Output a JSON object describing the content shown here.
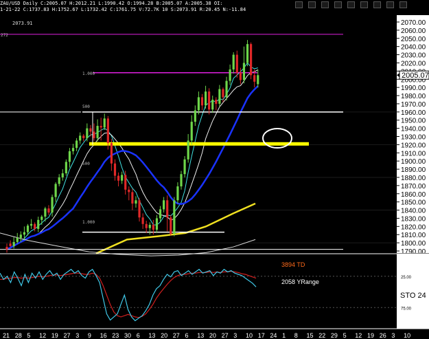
{
  "header": {
    "line1": "ZAU/USD  Daily  C:2005.07  H:2012.21  L:1990.42  O:1994.28  B:2005.07  A:2005.38  OI:",
    "line2": "1-21-22  C:1737.83  H:1752.67  L:1732.42  C:1761.75  V:72.7K  10  S:2073.91  R:20.45  N:-11.84",
    "ref_price": "2073.91"
  },
  "toolbar": {
    "buttons": [
      "arrow-down-icon",
      "pencil-icon",
      "zoom-icon",
      "cursor-icon",
      "box-icon",
      "arrow-down-icon",
      "plus-icon",
      "minus-icon",
      "close-icon"
    ]
  },
  "left_labels": [
    "272",
    "1.000",
    "500",
    "1.000",
    "500"
  ],
  "chart_data": {
    "type": "candlestick",
    "y_axis": {
      "min": 1780,
      "max": 2075,
      "ticks": [
        "2070.00",
        "2060.00",
        "2050.00",
        "2040.00",
        "2030.00",
        "2020.00",
        "2010.00",
        "2000.00",
        "1990.00",
        "1980.00",
        "1970.00",
        "1960.00",
        "1950.00",
        "1940.00",
        "1930.00",
        "1920.00",
        "1910.00",
        "1900.00",
        "1890.00",
        "1880.00",
        "1870.00",
        "1860.00",
        "1850.00",
        "1840.00",
        "1830.00",
        "1820.00",
        "1810.00",
        "1800.00",
        "1790.00"
      ]
    },
    "last_price_label": "2005.07",
    "x_tick_labels": [
      "21",
      "28",
      "5",
      "12",
      "19",
      "27",
      "3",
      "9",
      "16",
      "23",
      "30",
      "6",
      "13",
      "20",
      "27",
      "6",
      "13",
      "20",
      "27",
      "3",
      "10",
      "17",
      "24",
      "1",
      "8",
      "15",
      "22",
      "29",
      "5",
      "12",
      "19",
      "26",
      "3",
      "10"
    ],
    "candles": [
      [
        1795,
        1792,
        1788,
        1799
      ],
      [
        1799,
        1796,
        1795,
        1803
      ],
      [
        1796,
        1801,
        1793,
        1807
      ],
      [
        1801,
        1806,
        1799,
        1812
      ],
      [
        1806,
        1810,
        1801,
        1814
      ],
      [
        1810,
        1813,
        1804,
        1820
      ],
      [
        1813,
        1821,
        1809,
        1823
      ],
      [
        1821,
        1823,
        1817,
        1829
      ],
      [
        1823,
        1817,
        1814,
        1825
      ],
      [
        1817,
        1828,
        1813,
        1832
      ],
      [
        1828,
        1832,
        1822,
        1834
      ],
      [
        1832,
        1842,
        1826,
        1844
      ],
      [
        1842,
        1837,
        1834,
        1846
      ],
      [
        1837,
        1856,
        1832,
        1859
      ],
      [
        1856,
        1872,
        1850,
        1874
      ],
      [
        1872,
        1880,
        1869,
        1884
      ],
      [
        1880,
        1885,
        1876,
        1890
      ],
      [
        1885,
        1899,
        1882,
        1902
      ],
      [
        1899,
        1912,
        1892,
        1916
      ],
      [
        1912,
        1916,
        1908,
        1921
      ],
      [
        1916,
        1925,
        1912,
        1928
      ],
      [
        1925,
        1931,
        1921,
        1935
      ],
      [
        1931,
        1928,
        1924,
        1933
      ],
      [
        1928,
        1940,
        1924,
        1946
      ],
      [
        1940,
        1936,
        1930,
        1944
      ],
      [
        1936,
        1928,
        1925,
        1946
      ],
      [
        1928,
        1943,
        1924,
        1951
      ],
      [
        1943,
        1941,
        1925,
        1953
      ],
      [
        1941,
        1952,
        1938,
        1958
      ],
      [
        1952,
        1922,
        1914,
        1955
      ],
      [
        1922,
        1897,
        1888,
        1927
      ],
      [
        1897,
        1882,
        1876,
        1902
      ],
      [
        1882,
        1876,
        1869,
        1886
      ],
      [
        1876,
        1883,
        1872,
        1887
      ],
      [
        1883,
        1865,
        1859,
        1888
      ],
      [
        1865,
        1862,
        1852,
        1869
      ],
      [
        1862,
        1848,
        1840,
        1866
      ],
      [
        1848,
        1852,
        1843,
        1857
      ],
      [
        1852,
        1831,
        1826,
        1855
      ],
      [
        1831,
        1823,
        1817,
        1836
      ],
      [
        1823,
        1818,
        1812,
        1827
      ],
      [
        1818,
        1822,
        1810,
        1825
      ],
      [
        1822,
        1816,
        1810,
        1828
      ],
      [
        1816,
        1830,
        1812,
        1834
      ],
      [
        1830,
        1841,
        1826,
        1845
      ],
      [
        1841,
        1852,
        1837,
        1856
      ],
      [
        1852,
        1831,
        1814,
        1858
      ],
      [
        1831,
        1811,
        1809,
        1834
      ],
      [
        1811,
        1852,
        1808,
        1856
      ],
      [
        1852,
        1869,
        1848,
        1874
      ],
      [
        1869,
        1884,
        1865,
        1888
      ],
      [
        1884,
        1902,
        1880,
        1906
      ],
      [
        1902,
        1925,
        1898,
        1933
      ],
      [
        1925,
        1948,
        1920,
        1956
      ],
      [
        1948,
        1962,
        1943,
        1968
      ],
      [
        1962,
        1978,
        1957,
        1985
      ],
      [
        1978,
        1968,
        1962,
        1982
      ],
      [
        1968,
        1985,
        1964,
        1992
      ],
      [
        1985,
        1963,
        1957,
        1989
      ],
      [
        1963,
        1975,
        1959,
        1980
      ],
      [
        1975,
        1970,
        1962,
        1978
      ],
      [
        1970,
        1988,
        1966,
        1993
      ],
      [
        1988,
        1978,
        1972,
        1990
      ],
      [
        1978,
        1998,
        1974,
        2003
      ],
      [
        1998,
        2012,
        1993,
        2018
      ],
      [
        2012,
        2030,
        2007,
        2033
      ],
      [
        2030,
        2008,
        2002,
        2035
      ],
      [
        2008,
        1999,
        1994,
        2014
      ],
      [
        1999,
        2020,
        1995,
        2040
      ],
      [
        2020,
        2043,
        2016,
        2048
      ],
      [
        2043,
        2005,
        2000,
        2045
      ],
      [
        2005,
        1997,
        1990,
        2012
      ],
      [
        1994,
        2005,
        1990,
        2012
      ]
    ],
    "horizontal_levels": [
      {
        "name": "fib-272",
        "value": 2055,
        "color": "#e020e0"
      },
      {
        "name": "fib-1000-upper",
        "value": 2008,
        "color": "#e020e0"
      },
      {
        "name": "fib-500",
        "value": 1960,
        "color": "#ffffff"
      },
      {
        "name": "support-resistance",
        "value": 1921,
        "color": "#ffff00"
      },
      {
        "name": "fib-1000-lower",
        "value": 1813,
        "color": "#ffffff"
      }
    ],
    "indicator": {
      "y_ticks": [
        "25.00",
        "75.00"
      ],
      "labels": [
        {
          "text": "3894 TD",
          "color": "#ff6a1a"
        },
        {
          "text": "2058 YRange",
          "color": "#ffffff"
        }
      ],
      "side_label": "STO  24"
    }
  }
}
